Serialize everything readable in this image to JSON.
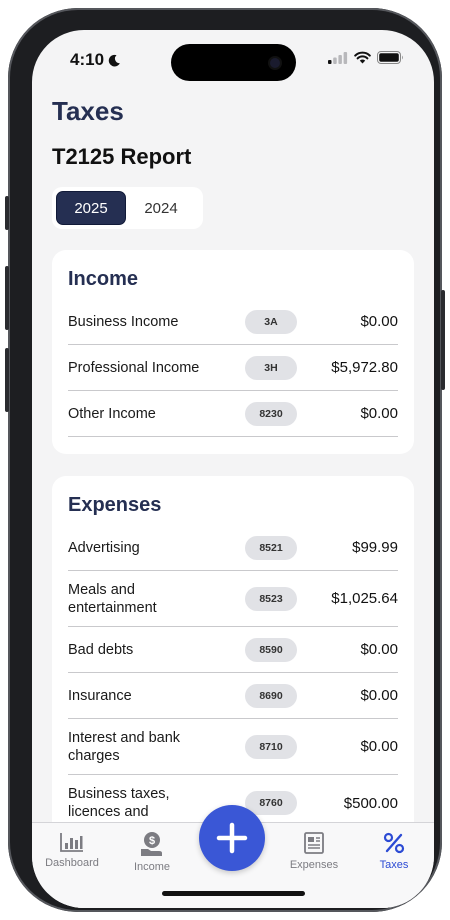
{
  "status": {
    "time": "4:10"
  },
  "header": {
    "title": "Taxes",
    "subtitle": "T2125 Report"
  },
  "years": [
    {
      "label": "2025",
      "active": true
    },
    {
      "label": "2024",
      "active": false
    }
  ],
  "income": {
    "title": "Income",
    "rows": [
      {
        "label": "Business Income",
        "code": "3A",
        "amount": "$0.00"
      },
      {
        "label": "Professional Income",
        "code": "3H",
        "amount": "$5,972.80"
      },
      {
        "label": "Other Income",
        "code": "8230",
        "amount": "$0.00"
      }
    ]
  },
  "expenses": {
    "title": "Expenses",
    "rows": [
      {
        "label": "Advertising",
        "code": "8521",
        "amount": "$99.99"
      },
      {
        "label": "Meals and entertainment",
        "code": "8523",
        "amount": "$1,025.64"
      },
      {
        "label": "Bad debts",
        "code": "8590",
        "amount": "$0.00"
      },
      {
        "label": "Insurance",
        "code": "8690",
        "amount": "$0.00"
      },
      {
        "label": "Interest and bank charges",
        "code": "8710",
        "amount": "$0.00"
      },
      {
        "label": "Business taxes, licences and",
        "code": "8760",
        "amount": "$500.00"
      }
    ]
  },
  "tabbar": {
    "dashboard": "Dashboard",
    "income": "Income",
    "expenses": "Expenses",
    "taxes": "Taxes",
    "add_icon": "plus-icon"
  },
  "colors": {
    "navy": "#252f52",
    "accent": "#3a57d6",
    "active_tab": "#2c4bd4"
  }
}
